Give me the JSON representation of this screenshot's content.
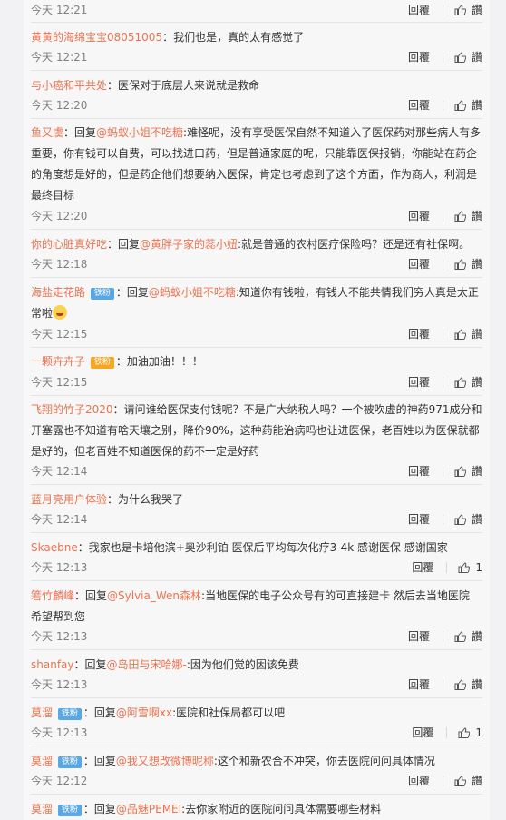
{
  "actions": {
    "reply": "回覆",
    "like": "讚"
  },
  "badges": {
    "fan": "铁粉"
  },
  "comments": [
    {
      "user": "",
      "sep": "",
      "reply_to": "",
      "text": "",
      "time": "今天 12:21",
      "like": "讚"
    },
    {
      "user": "黄黄的海绵宝宝08051005",
      "sep": "：",
      "reply_to": "",
      "text": "我们也是，真的太有感觉了",
      "time": "今天 12:21",
      "like": "讚"
    },
    {
      "user": "与小癌和平共处",
      "sep": "：",
      "reply_to": "",
      "text": "医保对于底层人来说就是救命",
      "time": "今天 12:20",
      "like": "讚"
    },
    {
      "user": "鱼又虞",
      "sep": "：回复",
      "reply_to": "@蚂蚁小姐不吃糖",
      "text": ":难怪呢，没有享受医保自然不知道入了医保药对那些病人有多重要，你有钱可以自费，可以找进口药，但是普通家庭的呢，只能靠医保报销，你能站在药企的角度想是好的，但是药企他们想要纳入医保，肯定也考虑到了这个方面，作为商人，利润是最终目标",
      "time": "今天 12:20",
      "like": "讚"
    },
    {
      "user": "你的心脏真好吃",
      "sep": "：回复",
      "reply_to": "@黄胖子家的蕊小妞",
      "text": ":就是普通的农村医疗保险吗？还是还有社保啊。",
      "time": "今天 12:18",
      "like": "讚"
    },
    {
      "user": "海盐走花路",
      "sep": "：回复",
      "reply_to": "@蚂蚁小姐不吃糖",
      "text": ":知道你有钱啦，有钱人不能共情我们穷人真是太正常啦",
      "time": "今天 12:15",
      "like": "讚"
    },
    {
      "user": "一颗卉卉子",
      "sep": "：",
      "reply_to": "",
      "text": "加油加油！！！",
      "time": "今天 12:15",
      "like": "讚"
    },
    {
      "user": "飞翔的竹子2020",
      "sep": "：",
      "reply_to": "",
      "text": "请问谁给医保支付钱呢？不是广大纳税人吗？一个被吹虚的神药971成分和开塞露也不知道有啥天壤之别，降价90%，这种药能治病吗也让进医保，老百姓以为医保就都是好的，但老百姓不知道医保的药不一定是好药",
      "time": "今天 12:14",
      "like": "讚"
    },
    {
      "user": "蓝月亮用户体验",
      "sep": "：",
      "reply_to": "",
      "text": "为什么我哭了",
      "time": "今天 12:14",
      "like": "讚"
    },
    {
      "user": "Skaebne",
      "sep": "：",
      "reply_to": "",
      "text": "我家也是卡培他滨+奥沙利铂 医保后平均每次化疗3-4k 感谢医保 感谢国家",
      "time": "今天 12:13",
      "like": "1"
    },
    {
      "user": "箬竹麟峰",
      "sep": "：回复",
      "reply_to": "@Sylvia_Wen森林",
      "text": ":当地医保的电子公众号有的可直接建卡 然后去当地医院 希望帮到您",
      "time": "今天 12:13",
      "like": "讚"
    },
    {
      "user": "shanfay",
      "sep": "：回复",
      "reply_to": "@岛田与宋哈娜-",
      "text": ":因为他们觉的因该免费",
      "time": "今天 12:13",
      "like": "讚"
    },
    {
      "user": "莫溜",
      "sep": "：回复",
      "reply_to": "@阿雪啊xx",
      "text": ":医院和社保局都可以吧",
      "time": "今天 12:13",
      "like": "1"
    },
    {
      "user": "莫溜",
      "sep": "：回复",
      "reply_to": "@我又想改微博昵称",
      "text": ":这个和新农合不冲突，你去医院问问具体情况",
      "time": "今天 12:12",
      "like": "讚"
    },
    {
      "user": "莫溜",
      "sep": "：回复",
      "reply_to": "@品魅PEMEI",
      "text": ":去你家附近的医院问问具体需要哪些材料",
      "time": "",
      "like": ""
    }
  ]
}
